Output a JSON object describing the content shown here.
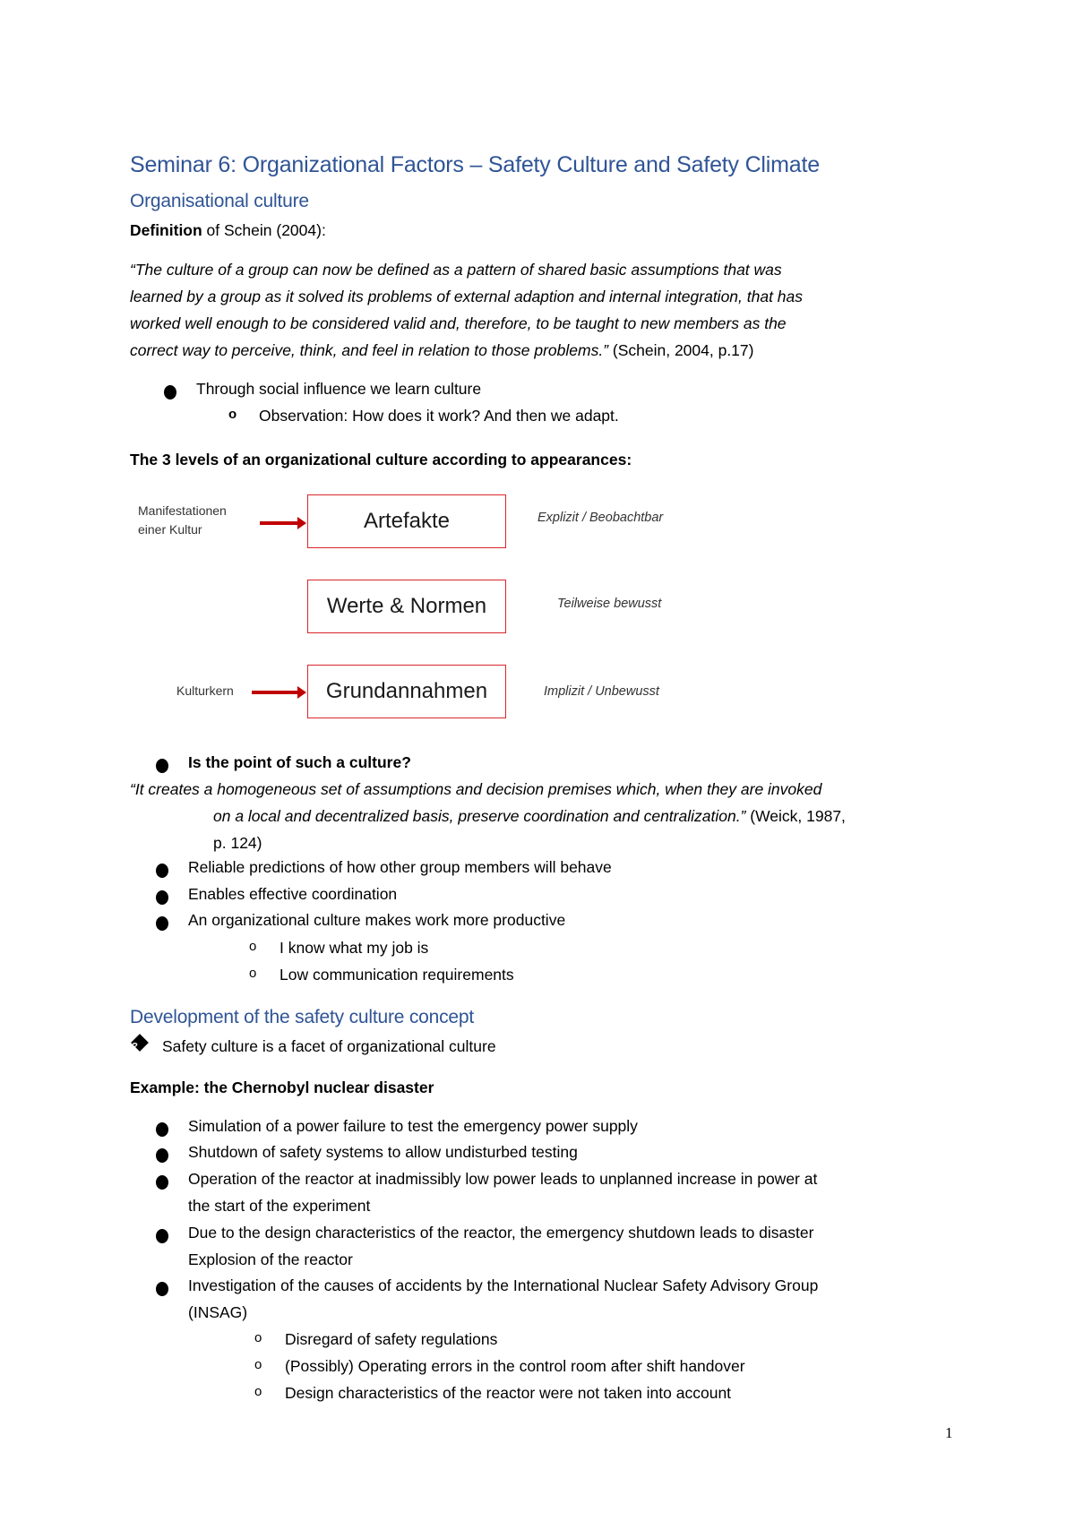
{
  "document": {
    "title": "Seminar 6: Organizational Factors – Safety Culture and Safety Climate",
    "page_number": "1"
  },
  "section1": {
    "heading": "Organisational culture",
    "definition_label_bold": "Definition",
    "definition_label_rest": " of Schein (2004):",
    "quote_lines": [
      "“The culture of a group can now be defined as a pattern of shared basic assumptions that was",
      "learned by a group as it solved its problems of external adaption and internal integration, that has",
      "worked well enough to be considered valid and, therefore, to be taught to new members as the",
      "correct way to perceive,  think, and feel in relation to those problems.”"
    ],
    "quote_citation": " (Schein, 2004, p.17)",
    "bullets": [
      {
        "text": "Through social influence we learn culture",
        "sub": [
          "Observation: How does it work? And then we adapt."
        ]
      }
    ],
    "levels_heading": "The 3 levels of an organizational culture according to appearances:",
    "diagram": {
      "levels": [
        {
          "box": "Artefakte",
          "desc": "Explizit / Beobachtbar"
        },
        {
          "box": "Werte & Normen",
          "desc": "Teilweise bewusst"
        },
        {
          "box": "Grundannahmen",
          "desc": "Implizit / Unbewusst"
        }
      ],
      "left_label_top_line1": "Manifestationen",
      "left_label_top_line2": "einer Kultur",
      "left_label_bottom": "Kulturkern",
      "box_border_color": "#d9262b",
      "arrow_color": "#c00000"
    },
    "point_heading": "Is the point of such a culture?",
    "weick_quote_line1": "“It creates a homogeneous set of assumptions and decision premises which, when they are invoked",
    "weick_quote_line2": "on a local and decentralized basis, preserve coordination and centralization.”",
    "weick_citation_part1": " (Weick, 1987,",
    "weick_citation_part2": "p. 124)",
    "point_bullets": [
      "Reliable predictions of how other group members will behave",
      "Enables effective coordination",
      "An organizational culture makes work more productive"
    ],
    "productive_sub": [
      "I know what my job is",
      "Low communication requirements"
    ]
  },
  "section2": {
    "heading": "Development of the safety culture concept",
    "facet_line": "Safety culture is a facet of organizational culture",
    "example_heading": "Example: the Chernobyl nuclear disaster",
    "bullets": [
      {
        "lines": [
          "Simulation of a power failure to test the emergency power supply"
        ]
      },
      {
        "lines": [
          "Shutdown of safety systems to allow undisturbed testing"
        ]
      },
      {
        "lines": [
          "Operation of the reactor at inadmissibly low power leads to unplanned increase in power at",
          "the start of the experiment"
        ]
      },
      {
        "lines": [
          "Due to the design characteristics of the reactor, the emergency shutdown leads to disaster",
          "Explosion of the reactor"
        ]
      },
      {
        "lines": [
          "Investigation of the causes of accidents by the International Nuclear Safety Advisory Group",
          "(INSAG)"
        ]
      }
    ],
    "insag_sub": [
      "Disregard of safety regulations",
      "(Possibly) Operating errors in the control room after shift handover",
      "Design characteristics of the reactor were not taken into account"
    ]
  },
  "colors": {
    "heading_blue": "#2f5496",
    "text": "#000000",
    "diagram_red": "#d9262b"
  }
}
